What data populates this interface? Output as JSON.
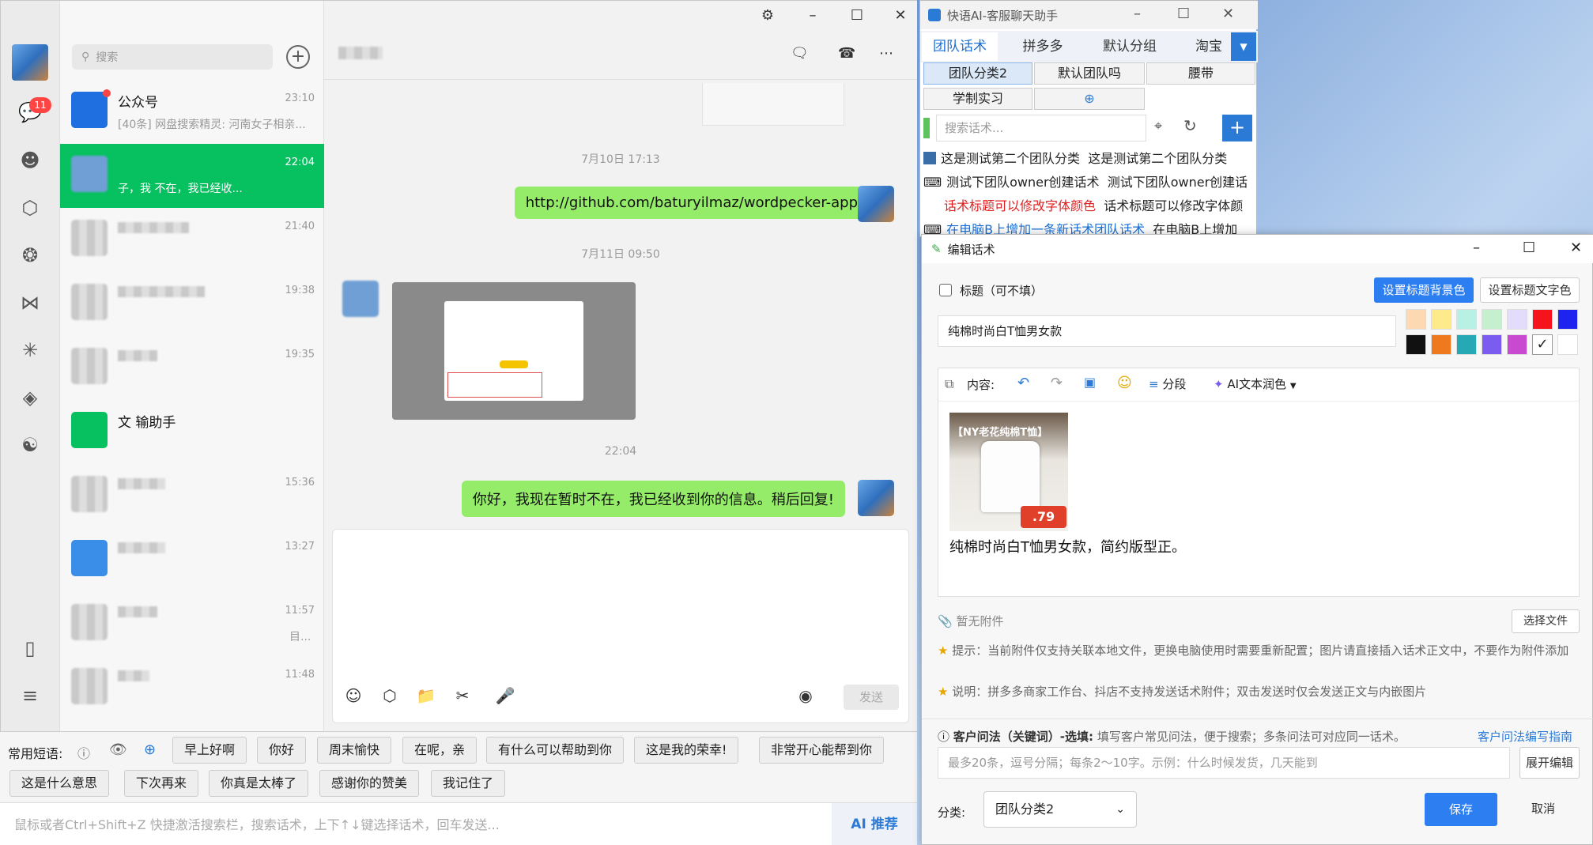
{
  "wechat": {
    "badge": "11",
    "search_placeholder": "搜索",
    "chats": [
      {
        "name": "公众号",
        "time": "23:10",
        "msg": "[40条] 网盘搜索精灵: 河南女子相亲..."
      },
      {
        "name": "",
        "time": "22:04",
        "msg": "子，我 不在，我已经收..."
      },
      {
        "name": "",
        "time": "21:40",
        "msg": ""
      },
      {
        "name": "",
        "time": "19:38",
        "msg": ""
      },
      {
        "name": "",
        "time": "19:35",
        "msg": ""
      },
      {
        "name": "文 输助手",
        "time": "",
        "msg": ""
      },
      {
        "name": "",
        "time": "15:36",
        "msg": ""
      },
      {
        "name": "",
        "time": "13:27",
        "msg": ""
      },
      {
        "name": "",
        "time": "11:57",
        "msg": "目..."
      },
      {
        "name": "",
        "time": "11:48",
        "msg": ""
      }
    ],
    "conversation": {
      "time1": "7月10日 17:13",
      "msg1": "http://github.com/baturyilmaz/wordpecker-app",
      "time2": "7月11日 09:50",
      "time3": "22:04",
      "msg2": "你好，我现在暂时不在，我已经收到你的信息。稍后回复!"
    },
    "send_label": "发送"
  },
  "phrases": {
    "label": "常用短语:",
    "chips": [
      "早上好啊",
      "你好",
      "周末愉快",
      "在呢，亲",
      "有什么可以帮助到你",
      "这是我的荣幸!",
      "非常开心能帮到你",
      "这是什么意思",
      "下次再来",
      "你真是太棒了",
      "感谢你的赞美",
      "我记住了"
    ],
    "input_placeholder": "鼠标或者Ctrl+Shift+Z 快捷激活搜索栏，搜索话术，上下↑↓键选择话术，回车发送...",
    "ai_button": "AI 推荐"
  },
  "assistant": {
    "title": "快语AI-客服聊天助手",
    "tabs": [
      "团队话术",
      "拼多多",
      "默认分组",
      "淘宝"
    ],
    "categories": [
      "团队分类2",
      "默认团队吗",
      "腰带",
      "学制实习"
    ],
    "search_placeholder": "搜索话术...",
    "rows": [
      {
        "title": "这是测试第二个团队分类",
        "content": "这是测试第二个团队分类",
        "color": "#111111"
      },
      {
        "title": "测试下团队owner创建话术",
        "content": "测试下团队owner创建话",
        "color": "#111111"
      },
      {
        "title": "话术标题可以修改字体颜色",
        "content": "话术标题可以修改字体颜",
        "color": "#e02020"
      },
      {
        "title": "在电脑B上增加一条新话术团队话术",
        "content": "在电脑B上增加",
        "color": "#1a6fd6"
      }
    ]
  },
  "editor": {
    "title": "编辑话术",
    "title_checkbox_label": "标题（可不填）",
    "set_bg_label": "设置标题背景色",
    "set_text_label": "设置标题文字色",
    "title_value": "纯棉时尚白T恤男女款",
    "swatch_colors": [
      "#fcd9b0",
      "#fdeb8b",
      "#b8f0e4",
      "#c4f0cf",
      "#e4dcfb",
      "#f5141b",
      "#1d24f0",
      "#111111",
      "#f0781e",
      "#26a8b5",
      "#7a5cf0",
      "#c94ad0",
      "#ffffff",
      "#ffffff"
    ],
    "content_label": "内容:",
    "segment_label": "分段",
    "ai_polish_label": "AI文本润色",
    "product_image_text": "【NY老花纯棉T恤】",
    "price_text": ".79",
    "content_text": "纯棉时尚白T恤男女款，简约版型正。",
    "attachment_label": "暂无附件",
    "choose_file_label": "选择文件",
    "tip1": "提示：当前附件仅支持关联本地文件，更换电脑使用时需要重新配置；图片请直接插入话术正文中，不要作为附件添加",
    "tip2": "说明：拼多多商家工作台、抖店不支持发送话术附件；双击发送时仅会发送正文与内嵌图片",
    "question_label": "客户问法（关键词）-选填:",
    "question_desc": "填写客户常见问法，便于搜索；多条问法可对应同一话术。",
    "question_guide_link": "客户问法编写指南",
    "question_placeholder": "最多20条，逗号分隔；每条2～10字。示例：什么时候发货，几天能到",
    "expand_label": "展开编辑",
    "category_label": "分类:",
    "category_value": "团队分类2",
    "save_label": "保存",
    "cancel_label": "取消"
  }
}
